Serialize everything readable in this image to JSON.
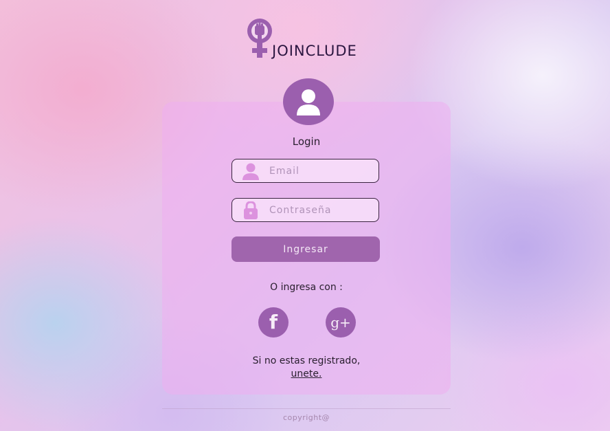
{
  "brand": {
    "name": "JOINCLUDE",
    "logo_icon": "venus-fist-icon"
  },
  "login": {
    "title": "Login",
    "avatar_icon": "user-avatar-icon",
    "email": {
      "placeholder": "Email",
      "icon": "user-icon"
    },
    "password": {
      "placeholder": "Contraseña",
      "icon": "lock-icon"
    },
    "submit_label": "Ingresar",
    "social_prompt": "O ingresa con :",
    "social": [
      {
        "name": "facebook",
        "icon": "facebook-icon",
        "glyph": "f"
      },
      {
        "name": "google-plus",
        "icon": "google-plus-icon",
        "glyph": "g+"
      }
    ],
    "register_text": "Si no estas registrado,",
    "register_link": "unete."
  },
  "footer": {
    "copyright": "copyright@"
  },
  "colors": {
    "accent": "#9b5fae",
    "button": "#a065ad",
    "text": "#2b2030"
  }
}
